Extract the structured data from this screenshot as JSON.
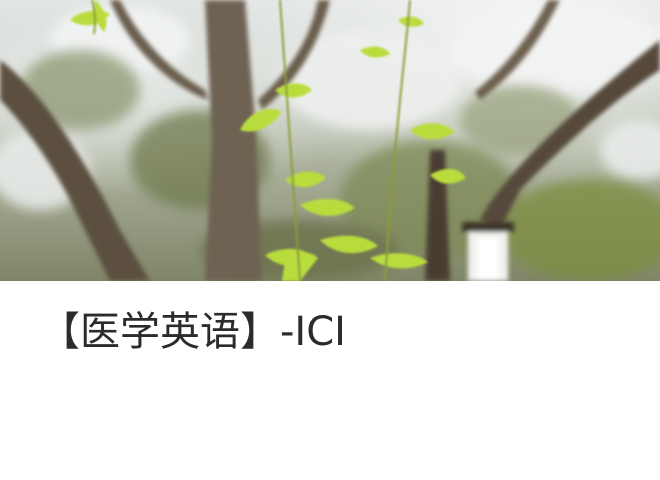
{
  "hero": {
    "description_icon": "tree-branch-photo"
  },
  "title": {
    "text": "【医学英语】-ICI"
  }
}
